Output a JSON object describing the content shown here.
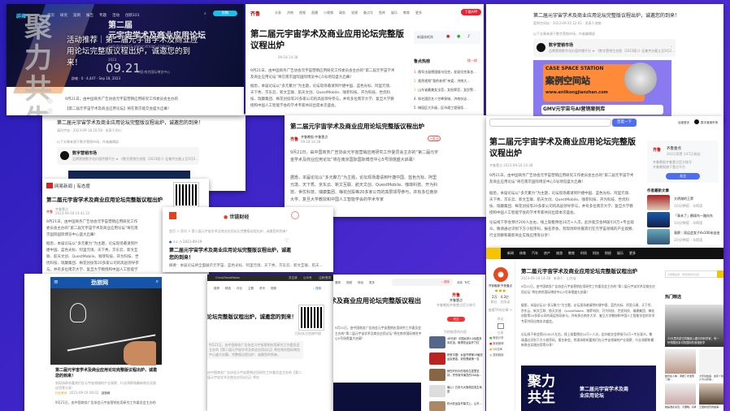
{
  "title": "第二届元宇宙学术及商业应用论坛完整版议程出炉",
  "title_long": "第二届元宇宙学术及商业应用论坛完整版议程出炉，诚邀您的到来！",
  "p1": {
    "logo": "辟雍",
    "nav": [
      "首页",
      "研究",
      "案例",
      "报告",
      "专题",
      "活动",
      "创新101"
    ],
    "cta": "投稿",
    "banner_big": "聚力共生",
    "banner_h1": "第二届",
    "banner_h2": "元宇宙学术及商业应用论坛",
    "banner_en": "AND BUSINESS APPLICATIONS FORUM",
    "banner_date": "09.21",
    "banner_year": "2023",
    "banner_place": "中国·南京国际博览中心",
    "headline": "活动推荐｜第二届元宇宙学术及商业应用论坛完整版议程出炉，诚邀您的到来！",
    "meta": "辟雍 · 0 · 4,447 · Sep 18, 2023",
    "body1": "9月21日，由中国商务广告协会元宇宙营销应用研究工作委员会主办的",
    "body2": "【第二届元宇宙学术及商业应用论坛】将在南京能交会盛大启幕！"
  },
  "p2": {
    "logo": "齐鲁",
    "nav": [
      "头条",
      "济南",
      "视频",
      "直播",
      "小视频",
      "政务",
      "党建",
      "鲁点号",
      "智库",
      "娱乐",
      "教育",
      "更多"
    ],
    "download": "下载APP",
    "meta": "09-18 14:38",
    "share_label": "新媒体矩阵",
    "rank_title": "鲁点热榜",
    "rank_more": "换一换",
    "rank": [
      "俄军击毁德国援乌坦克，发现坦克乘坐...",
      "竟然视频“我的老师”亲爱，济南大...",
      "山东省最美女法官，女检察官，女民警...",
      "知名国民艺人空降泉城，济南仅这...",
      "梅园区大升级，区市政工程接续..."
    ],
    "body1": "9月21日，由中国商务广告协会元宇宙营销应用研究工作委员会主办的“第二届元宇宙学术及商业应用论坛”将在南京国际国际博览中心5号场馆盛大启幕！",
    "body2": "据悉，本届论坛以“多元聚力”为主题，论坛现场邀请到叶捷中国、蓝色光标、阿里元境、天下秀、京东云、新文互联、航天文创、QuestMobile、咖菲科技、开为科技、世优科技、瑞康集团、梅花创投等20多家公司的高层领导参与，并有多位南京大学、复旦大学教授和中国人工智能学会的学术专家共同出席本次盛会。"
  },
  "p3": {
    "meta": "案例空间站 · 2023-09-20 12:01 · 发表于湖南",
    "note": "以下文章来源于数字营销市场，作者编辑部",
    "account": "数字营销市场",
    "account_desc": "品牌营销数字化价值传播平台 ★ 《数字营销生态图（2023版）》征集传名截止至9月2...",
    "case_title": "CASE SPACE STATION",
    "case_cn": "案例空间站",
    "case_url": "www.anlikongjianzhan.com",
    "case_sub": "GMV元宇宙与AI营销案例库"
  },
  "p4": {
    "meta": "清风宇宙 · 2023-09-18 20:58 · 发表于四川",
    "note": "以下文章来源于数字营销市场，作者编辑部",
    "account": "数字营销市场",
    "account_desc": "品牌营销数字化价值传播平台 ★ 《数字营销生态图（2023版）》征集传名截止至9月2..."
  },
  "p5": {
    "source": "齐鲁晚报·齐鲁壹点",
    "date": "09.18 14:38",
    "follow": "+关注",
    "body1": "9月21日，由中国商务广告协会元宇宙营销应用研究工作委员会主办的“第二届元宇宙学术及商业应用论坛”将在南京国际国际博览中心5号场馆盛大启幕！",
    "body2": "据悉，本届论坛以“多元聚力”为主题，论坛现场邀请到叶捷中国、蓝色光标、阿里元境、天下秀、京东云、新文互联、航天文创、QuestMobile、咖菲科技、开为科技、世优科技、瑞康集团、梅花创投等20多家公司的高层领导参与，并有多位南京大学、复旦大学教授和中国人工智能学会的学术专家"
  },
  "p6": {
    "search_btn": "百度一下",
    "home": "百度首页",
    "user": "数字营销市场",
    "source": "齐鲁壹点",
    "date": "2023-09-18 14:38",
    "author": "齐鲁壹点",
    "author_stats": "343万获赞 14.5万粉丝",
    "author_desc1": "齐鲁晚报齐鲁壹点官方账号",
    "author_desc2": "齐鲁晚报旗下壹点平台",
    "follow": "关注",
    "latest": "作者最新文章",
    "articles": [
      "大明湖的王莽",
      "「青未了」鹊颂鸟一路向东",
      "观察｜双运会女子4x100米自由泳接力，杨浚瑄为山东夺..."
    ],
    "articles_meta": [
      "10分钟前 · 0阅读",
      "10分钟前 · 0阅读",
      "20分钟前 · 0阅读"
    ],
    "body1": "9月21日，由中国商务广告协会元宇宙营销应用研究工作委员会主办的“第二届元宇宙学术及商业应用论坛”将在南京国际博览中心5号场馆盛大启幕！",
    "body2": "据悉，本届论坛以“多元聚力”为主题，论坛现场邀请到叶捷中国、蓝色光标、阿里元境、天下秀、京东云、新文互联、航天文创、QuestMobile、咖菲科技、开为科技、世优科技、瑞康集团、梅花创投等20多家公司的高层领导参与，并有多位南京大学、复旦大学教授和中国人工智能学会的学术专家共同出席本次盛会。",
    "body3": "论坛线下参会预计200人左右，线上观看预估10万+人次，此外能交会将吸引4万+专业观众。敬请通过识别下方小程序码，报名参会，到现场聆听嘉宾们在元宇宙领域的产业观察、行业洞察和最新商业实践应用等分享！"
  },
  "p7": {
    "logo": "网易新闻",
    "logo2": "有态度",
    "source": "齐鲁壹点",
    "date": "2023-09-18 14:41:22",
    "body1": "9月21日，由中国商务广告协会元宇宙营销应用研究工作委员会主办的“第二届元宇宙学术及商业应用论坛”将在南京国际国际博览中心盛大启幕！",
    "body2": "据悉，本届论坛以“多元聚力”为主题，论坛现场邀请到叶捷中国、蓝色光标、阿里元境、天下秀、京东云、新文互联、航天文创、QuestMobile、咖菲科技、开为科技、世优科技、瑞康集团、梅花创投等20多家公司的高层领导参与，并有多位南京大学、复旦大学教授和中国人工智能学会的学术专家共同出席本次盛会。"
  },
  "p8": {
    "logo": "世链财经",
    "crumb": "首页 > 资讯 > 第二届元宇宙学术及商业应用论坛完整版议程出炉，诚邀您的到来！",
    "author": "小c",
    "date": "2023-09-19",
    "summary": "摘要：本届论坛将全面展示元宇宙、蓝色光标、阿里元境、天下秀、京东云、新文互联、航天..."
  },
  "p9": {
    "logo": "劲旅网",
    "excerpt": "到现场聆听嘉宾们在元宇宙领域的产业观察、行业洞察和最新商业实践应用等分享！",
    "tag": "行业资讯",
    "date": "2023-09-19 09:02",
    "author": "劲旅网",
    "body1": "9月21日，由中国商务广告协会元宇宙营销应用研究工作委员会主办的",
    "body2": "【第二届元宇宙学术及商业应用论坛】将在南京国际博览中心盛大启幕！"
  },
  "p10": {
    "brand": "ChinaTravelNews",
    "top_links": [
      "关注我",
      "公众号",
      "注册/登录"
    ],
    "nav": [
      "推荐",
      "精选",
      "评论",
      "主题",
      "资讯",
      "视频"
    ],
    "search": "搜索",
    "qr_caption": "扫码关注劲旅中国",
    "summary": "9月21日，由中国商务广告协会元宇宙营销应用研究工作委员会主办的【第二届元宇宙学术及商业应用论坛】将在南京国际博览中心盛大启幕。完整版议程出炉，诚邀您的到来。",
    "body": "由中国商务广告协会元宇宙营销应用研究工作委员会主办的【第二届元宇宙学术及商业应用论坛】将在"
  },
  "p11": {
    "nav": [
      "要闻",
      "视频",
      "财经",
      "更多"
    ],
    "search": "搜索",
    "links": [
      "消息",
      "专栏"
    ],
    "source": "齐鲁壹点",
    "author": "齐鲁壹点",
    "author_desc": "齐鲁晚报齐鲁壹点官方账号",
    "follow": "关注",
    "hot": "为你推荐的内容",
    "news": [
      "48分钟！中国女排3-0战胜多米尼加，取得亚运会开门红",
      "祝贺中国！女篮夺得第19届亚运会首金，双双晋级第一名",
      "他在时代中的电影生涯里坚持，齐鲁城市演员的200余...",
      "痛心！日本与大阪周边发生地震",
      "杭州亚运会开幕式上，山东..."
    ],
    "body1": "9月21日，由中国商务广告协会元宇宙营销应用研究工作委员会主办的“第二届元宇宙学术及商业应用论坛”将在南京国际博览中心5号场馆盛大启幕！",
    "body2": "据悉，本届论坛以“多元聚力”为主题，论坛现场邀请到叶捷中国、蓝色光标、阿里元境、天下秀、京东云、新文互联、航天文创、QuestMobile、咖菲科技、开为科技、世优科技、瑞康集团、梅花创投等20多家公司的高层领导参与，并有多位南京大学、复旦大学教授和中国人工智能学会的学术专家共同出席本次盛会。",
    "body3": "论坛线下参会预计200人左右，线上观看预估10万+人次，此外能交会将吸引4万+专业观众，敬请通过识别下方小程序码，报名参会，到现场聆听嘉宾们在元宇宙领域的产业观察、行业洞察和最新商业实践应用等分享！"
  },
  "p12": {
    "nav": [
      "新闻",
      "体育",
      "汽车",
      "房产",
      "旅游",
      "教育",
      "时尚",
      "科技",
      "财经",
      "娱乐",
      "更多"
    ],
    "brand": "齐鲁晚报·齐鲁壹点",
    "fans": "2万",
    "fans_label": "粉丝",
    "articles": "4.2亿",
    "articles_label": "总阅读",
    "view_all": "查看TA的文章 >",
    "comment": "评论",
    "share": "分享",
    "share_items": [
      "微信分享",
      "新浪微博",
      "QQ空间",
      "复制链接"
    ],
    "date": "2023-09-18 14:38",
    "from": "来源于：山东省",
    "search_placeholder": "大家都在搜：学生党的平价包",
    "hot": "热门精选",
    "hot_caption": "33天里内蒙古同胞嵌入藏中的科学家，有一份残酷但亲切的国际的浪漫医学",
    "thumbs": [
      "她曾女人体，离婚了才发现了她...",
      "大环境热度，会有个别人可以获得...",
      "她是谁女演员，大器晚，好看...",
      "王国新经历的故事..."
    ],
    "banner_big": "聚力共生",
    "banner_h": "第二届元宇宙学术及商业应用论坛",
    "body1": "9月21日，由中国商务广告协会元宇宙营销应用研究工作委员会主办的“第二届元宇宙学术及商业应用论坛”将在南京国际博览中心5号场馆盛大启幕！",
    "body2": "据悉，本届论坛以“多元聚力”为主题，论坛现场邀请到叶捷中国、蓝色光标、阿里元境、天下秀、京东云、新文互联、航天文创、QuestMobile、咖菲科技、开为科技、世优科技、瑞康集团、梅花创投等20多家公司的高层领导参与，并有多位南京大学、复旦大学教授和中国人工智能学会的学术专家共同出席本次盛会。",
    "body3": "论坛线下参会预计200人左右，线上观看预估10万+人次，此外能交会将吸引4万+专业观众。敬请通过识别下方小程序码，报名参会，到现场聆听嘉宾们在元宇宙领域的产业观察、行业洞察和最新商业实践应用等分享！"
  }
}
